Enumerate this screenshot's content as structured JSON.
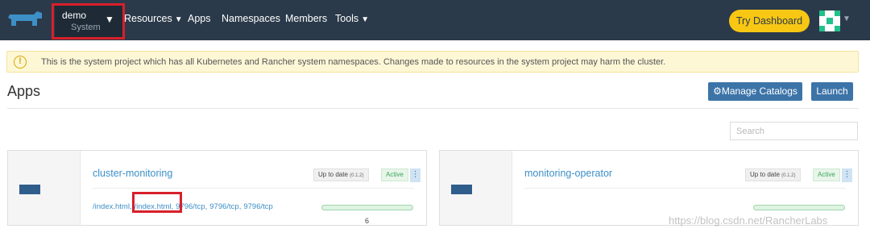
{
  "header": {
    "project": {
      "name": "demo",
      "sub": "System"
    },
    "nav": [
      {
        "label": "Resources",
        "dropdown": true
      },
      {
        "label": "Apps",
        "dropdown": false
      },
      {
        "label": "Namespaces",
        "dropdown": false
      },
      {
        "label": "Members",
        "dropdown": false
      },
      {
        "label": "Tools",
        "dropdown": true
      }
    ],
    "try_dashboard": "Try Dashboard"
  },
  "banner": {
    "text": "This is the system project which has all Kubernetes and Rancher system namespaces. Changes made to resources in the system project may harm the cluster."
  },
  "page": {
    "title": "Apps",
    "manage_catalogs": "Manage Catalogs",
    "launch": "Launch",
    "search_placeholder": "Search"
  },
  "apps": [
    {
      "name": "cluster-monitoring",
      "status_text": "Up to date",
      "version": "(0.1.2)",
      "state": "Active",
      "endpoints": [
        "/index.html,",
        "/index.html,",
        "9796/tcp,",
        "9796/tcp,",
        "9796/tcp"
      ],
      "pods": "6"
    },
    {
      "name": "monitoring-operator",
      "status_text": "Up to date",
      "version": "(0.1.2)",
      "state": "Active",
      "endpoints": [],
      "pods": ""
    }
  ],
  "watermark": "https://blog.csdn.net/RancherLabs",
  "colors": {
    "header": "#2b3a4a",
    "accent": "#3d74a8",
    "link": "#3d8fc7",
    "try": "#f7c713"
  }
}
